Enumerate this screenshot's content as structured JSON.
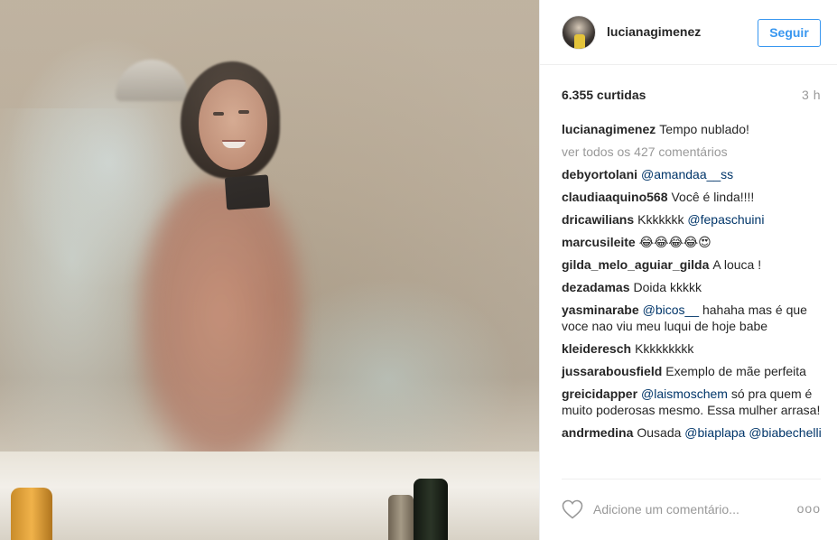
{
  "post": {
    "username": "lucianagimenez",
    "follow_label": "Seguir",
    "likes": "6.355 curtidas",
    "time_ago": "3 h",
    "caption": "Tempo nublado!",
    "view_all": "ver todos os 427 comentários"
  },
  "comments": [
    {
      "user": "debyortolani",
      "parts": [
        {
          "type": "mention",
          "text": "@amandaa__ss"
        }
      ]
    },
    {
      "user": "claudiaaquino568",
      "parts": [
        {
          "type": "text",
          "text": "Você é linda!!!!"
        }
      ]
    },
    {
      "user": "dricawilians",
      "parts": [
        {
          "type": "text",
          "text": "Kkkkkkk "
        },
        {
          "type": "mention",
          "text": "@fepaschuini"
        }
      ]
    },
    {
      "user": "marcusileite",
      "parts": [
        {
          "type": "text",
          "text": "😂😂😂😂😍"
        }
      ]
    },
    {
      "user": "gilda_melo_aguiar_gilda",
      "parts": [
        {
          "type": "text",
          "text": "A louca !"
        }
      ]
    },
    {
      "user": "dezadamas",
      "parts": [
        {
          "type": "text",
          "text": "Doida kkkkk"
        }
      ]
    },
    {
      "user": "yasminarabe",
      "parts": [
        {
          "type": "mention",
          "text": "@bicos__"
        },
        {
          "type": "text",
          "text": " hahaha mas é que voce nao viu meu luqui de hoje babe"
        }
      ]
    },
    {
      "user": "kleideresch",
      "parts": [
        {
          "type": "text",
          "text": "Kkkkkkkkk"
        }
      ]
    },
    {
      "user": "jussarabousfield",
      "parts": [
        {
          "type": "text",
          "text": "Exemplo de mãe perfeita"
        }
      ]
    },
    {
      "user": "greicidapper",
      "parts": [
        {
          "type": "mention",
          "text": "@laismoschem"
        },
        {
          "type": "text",
          "text": " só pra quem é muito poderosas mesmo. Essa mulher arrasa!"
        }
      ]
    },
    {
      "user": "andrmedina",
      "parts": [
        {
          "type": "text",
          "text": "Ousada "
        },
        {
          "type": "mention",
          "text": "@biaplapa"
        },
        {
          "type": "text",
          "text": " "
        },
        {
          "type": "mention",
          "text": "@biabechelli"
        }
      ]
    }
  ],
  "footer": {
    "comment_placeholder": "Adicione um comentário...",
    "more_label": "ooo",
    "heart_icon": "heart-outline-icon"
  },
  "colors": {
    "follow_blue": "#3897f0",
    "mention_blue": "#003569",
    "muted_gray": "#999999"
  }
}
